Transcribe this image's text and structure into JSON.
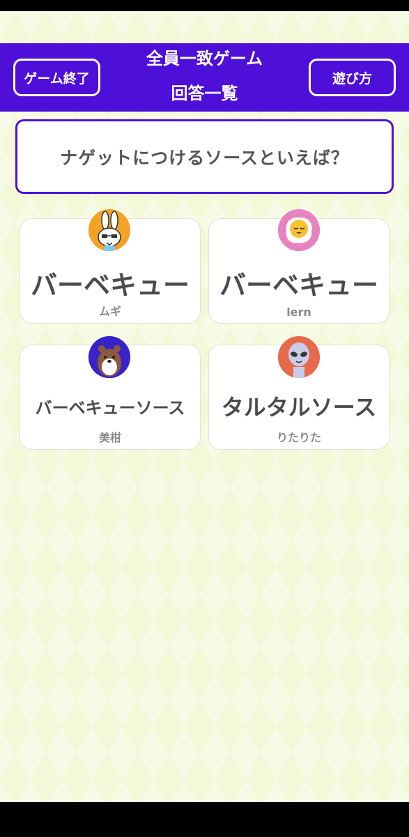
{
  "header": {
    "end_button_label": "ゲーム終了",
    "title_line1": "全員一致ゲーム",
    "title_line2": "回答一覧",
    "howto_button_label": "遊び方"
  },
  "question": "ナゲットにつけるソースといえば？",
  "answers": [
    {
      "answer": "バーベキュー",
      "name": "ムギ",
      "avatar": "rabbit-icon",
      "avatar_bg": "#f4a226"
    },
    {
      "answer": "バーベキュー",
      "name": "lern",
      "avatar": "fried-egg-icon",
      "avatar_bg": "#e784c0"
    },
    {
      "answer": "バーベキューソース",
      "name": "美柑",
      "avatar": "bear-icon",
      "avatar_bg": "#3a22c9"
    },
    {
      "answer": "タルタルソース",
      "name": "りたりた",
      "avatar": "alien-icon",
      "avatar_bg": "#e86a4c"
    }
  ],
  "colors": {
    "header": "#4e0fd8",
    "background": "#f3f9d8"
  }
}
